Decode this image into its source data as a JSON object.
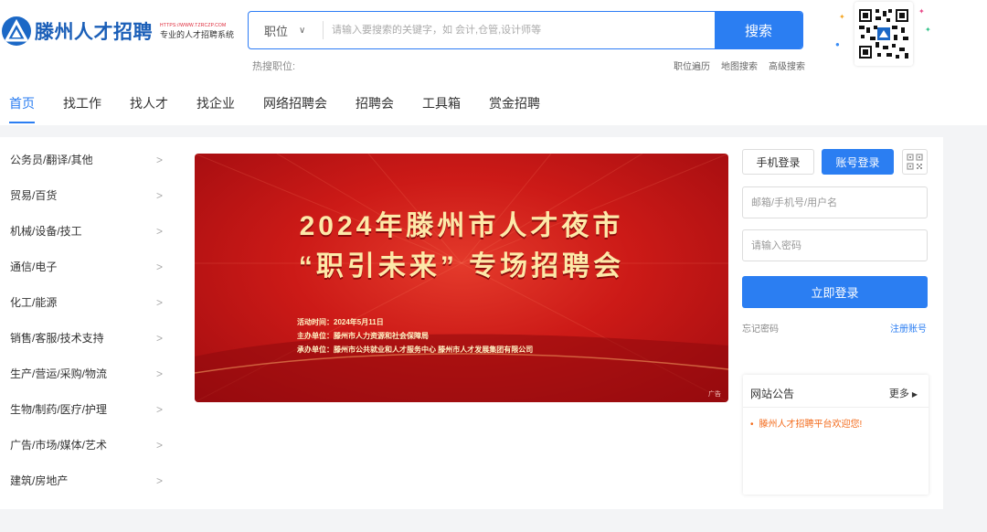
{
  "brand": {
    "name": "滕州人才招聘",
    "url": "HTTPS://WWW.TZRCZP.COM",
    "slogan": "专业的人才招聘系统"
  },
  "search": {
    "type_label": "职位",
    "placeholder": "请输入要搜索的关键字，如 会计,仓管,设计师等",
    "button_label": "搜索",
    "hot_label": "热搜职位:"
  },
  "search_links": [
    "职位遍历",
    "地图搜索",
    "高级搜索"
  ],
  "nav": [
    "首页",
    "找工作",
    "找人才",
    "找企业",
    "网络招聘会",
    "招聘会",
    "工具箱",
    "赏金招聘"
  ],
  "categories": [
    "公务员/翻译/其他",
    "贸易/百货",
    "机械/设备/技工",
    "通信/电子",
    "化工/能源",
    "销售/客服/技术支持",
    "生产/营运/采购/物流",
    "生物/制药/医疗/护理",
    "广告/市场/媒体/艺术",
    "建筑/房地产"
  ],
  "banner": {
    "title_line1": "2024年滕州市人才夜市",
    "title_line2": "“职引未来” 专场招聘会",
    "time": "活动时间：2024年5月11日",
    "host": "主办单位：滕州市人力资源和社会保障局",
    "organizer": "承办单位：滕州市公共就业和人才服务中心   滕州市人才发展集团有限公司",
    "ad_tag": "广告"
  },
  "login": {
    "tab_phone": "手机登录",
    "tab_account": "账号登录",
    "user_placeholder": "邮箱/手机号/用户名",
    "password_placeholder": "请输入密码",
    "submit_label": "立即登录",
    "forgot_label": "忘记密码",
    "register_label": "注册账号"
  },
  "notice": {
    "title": "网站公告",
    "more_label": "更多",
    "items": [
      "滕州人才招聘平台欢迎您!"
    ]
  },
  "colors": {
    "accent": "#2b7ef2",
    "brand": "#1b5fb8",
    "banner_red": "#cc1a17",
    "banner_gold": "#fde9a9",
    "notice_orange": "#f36b1c"
  }
}
